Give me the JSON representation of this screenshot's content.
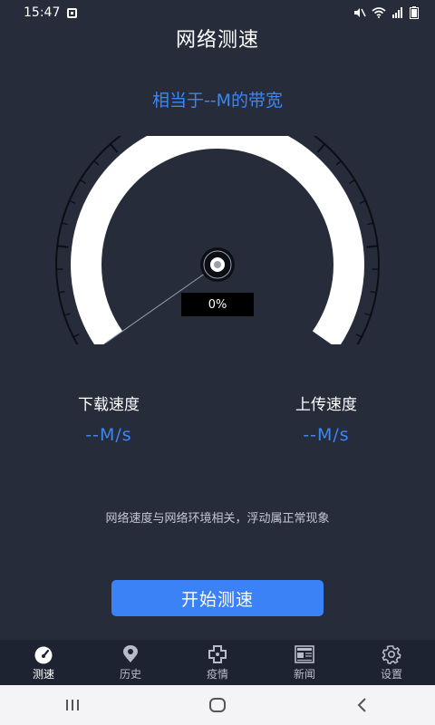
{
  "status_bar": {
    "time": "15:47",
    "icons": [
      "screen-record-icon",
      "mute-icon",
      "wifi-icon",
      "4g-icon",
      "battery-icon"
    ]
  },
  "app": {
    "title": "网络测速"
  },
  "bandwidth_text": "相当于--M的带宽",
  "gauge": {
    "percent_text": "0%",
    "progress": 0,
    "ticks": 30
  },
  "download": {
    "label": "下载速度",
    "value": "--M/s"
  },
  "upload": {
    "label": "上传速度",
    "value": "--M/s"
  },
  "note": "网络速度与网络环境相关，浮动属正常现象",
  "start_button": {
    "label": "开始测速"
  },
  "tabs": [
    {
      "label": "测速",
      "icon": "speedometer-icon",
      "active": true
    },
    {
      "label": "历史",
      "icon": "location-pin-icon",
      "active": false
    },
    {
      "label": "疫情",
      "icon": "medical-cross-icon",
      "active": false
    },
    {
      "label": "新闻",
      "icon": "newspaper-icon",
      "active": false
    },
    {
      "label": "设置",
      "icon": "gear-icon",
      "active": false
    }
  ],
  "colors": {
    "background": "#262c3a",
    "accent": "#3b86f7",
    "button": "#3b82f6",
    "tab_bar": "#1d2331"
  }
}
